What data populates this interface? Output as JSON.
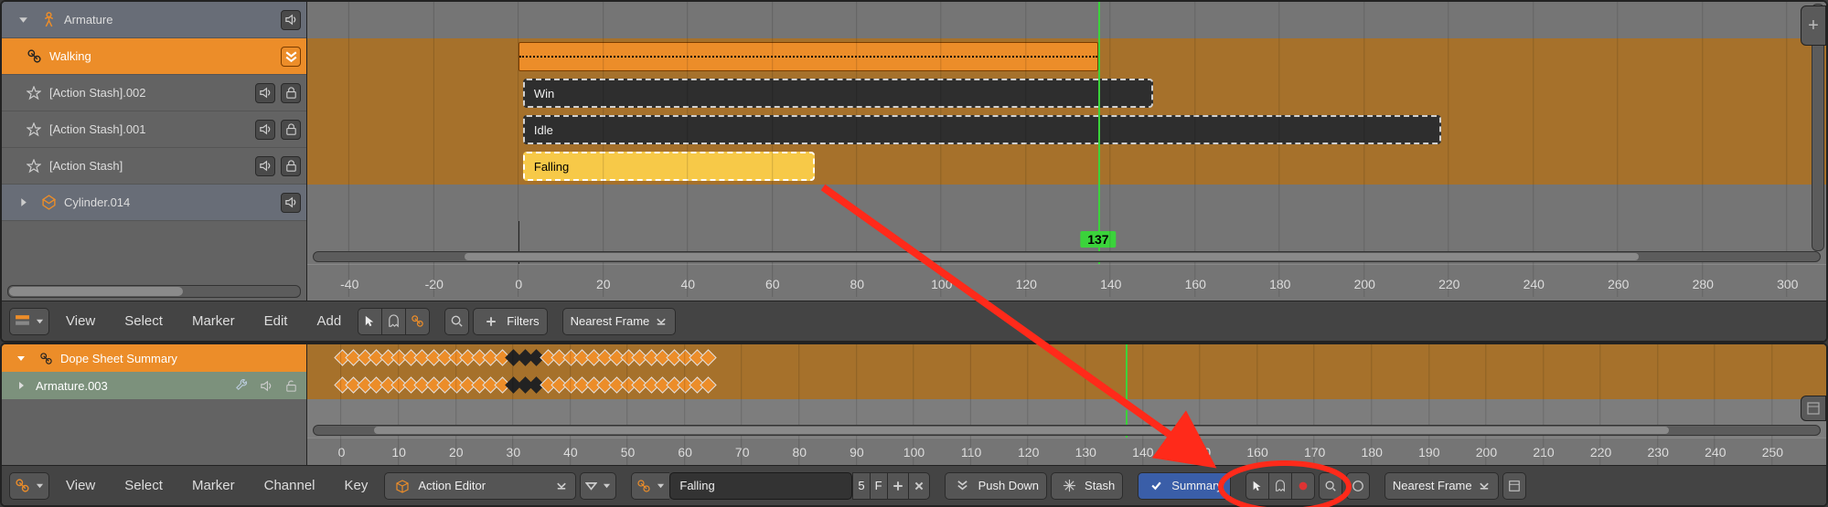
{
  "nla": {
    "tracks": {
      "armature": "Armature",
      "walking": "Walking",
      "stash2": "[Action Stash].002",
      "stash1": "[Action Stash].001",
      "stash0": "[Action Stash]",
      "cylinder": "Cylinder.014"
    },
    "strips": {
      "win": "Win",
      "idle": "Idle",
      "falling": "Falling"
    },
    "current_frame": "137",
    "ticks": [
      "-40",
      "-20",
      "0",
      "20",
      "40",
      "60",
      "80",
      "100",
      "120",
      "140",
      "160",
      "180",
      "200",
      "220",
      "240",
      "260",
      "280",
      "300"
    ]
  },
  "nla_header": {
    "menus": {
      "view": "View",
      "select": "Select",
      "marker": "Marker",
      "edit": "Edit",
      "add": "Add"
    },
    "filters": "Filters",
    "snap": "Nearest Frame"
  },
  "dope": {
    "rows": {
      "summary": "Dope Sheet Summary",
      "arm003": "Armature.003"
    },
    "ticks": [
      "0",
      "10",
      "20",
      "30",
      "40",
      "50",
      "60",
      "70",
      "80",
      "90",
      "100",
      "110",
      "120",
      "130",
      "140",
      "150",
      "160",
      "170",
      "180",
      "190",
      "200",
      "210",
      "220",
      "230",
      "240",
      "250"
    ]
  },
  "dope_header": {
    "menus": {
      "view": "View",
      "select": "Select",
      "marker": "Marker",
      "channel": "Channel",
      "key": "Key"
    },
    "mode": "Action Editor",
    "action_name": "Falling",
    "users": "5",
    "fake_user": "F",
    "push_down": "Push Down",
    "stash": "Stash",
    "summary": "Summary",
    "snap": "Nearest Frame"
  }
}
